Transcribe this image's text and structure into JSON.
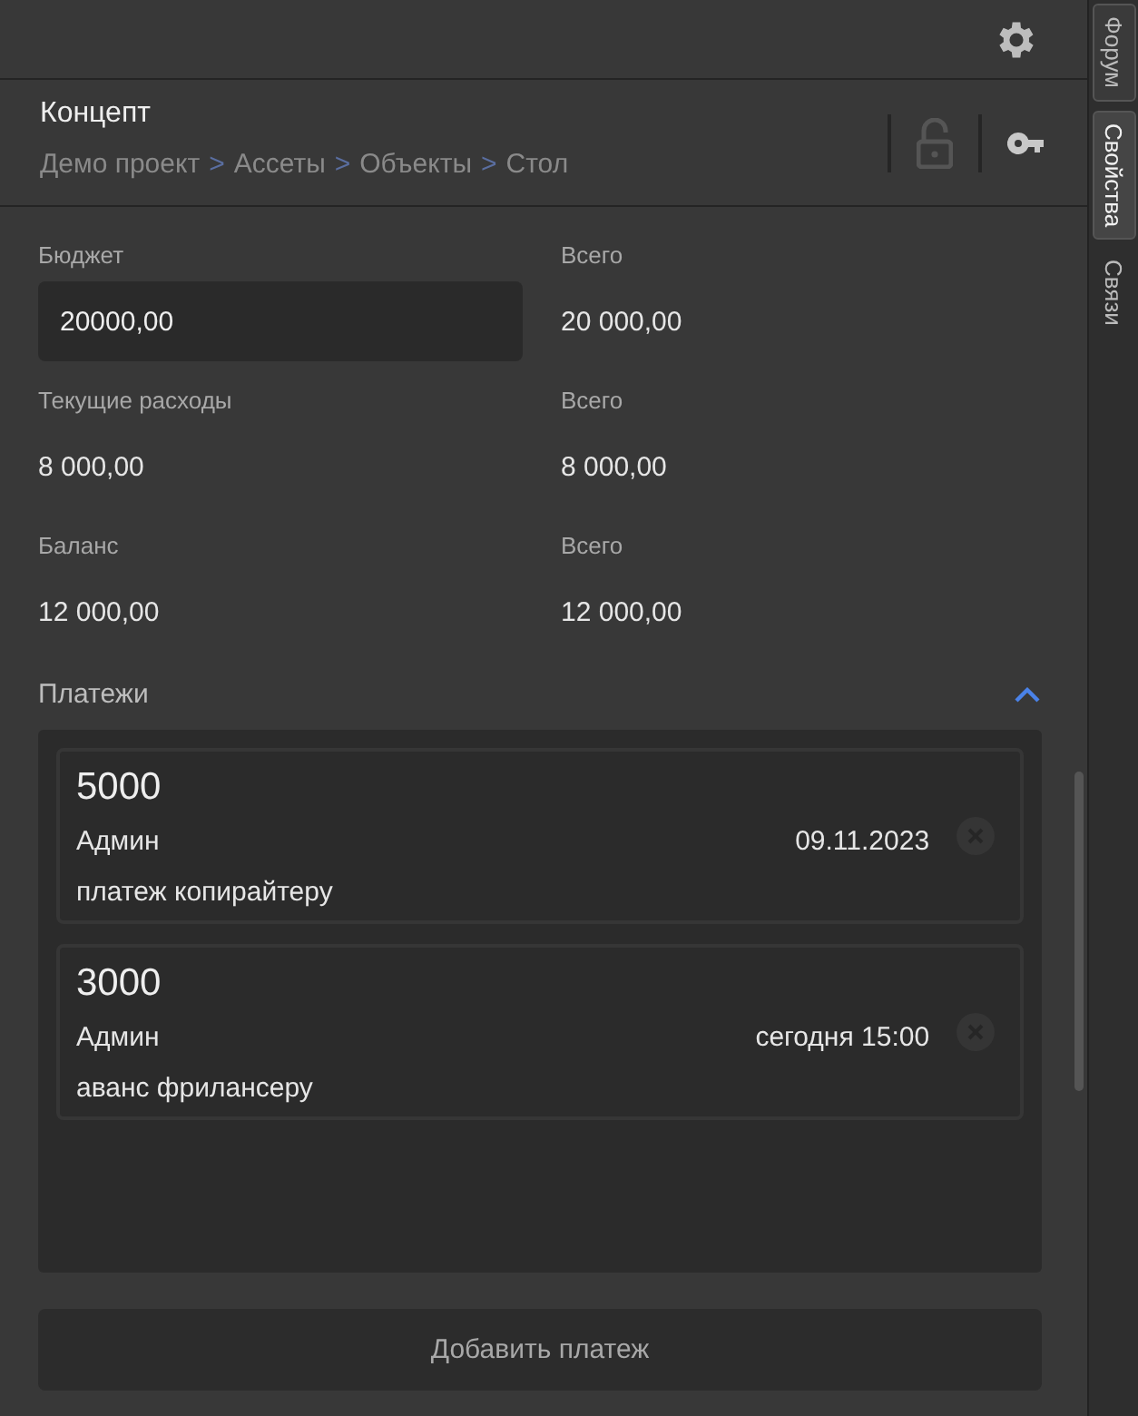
{
  "header": {
    "title": "Концепт",
    "breadcrumb": [
      {
        "kind": "crumb",
        "text": "Демо проект"
      },
      {
        "kind": "sep",
        "text": ">"
      },
      {
        "kind": "crumb",
        "text": "Ассеты"
      },
      {
        "kind": "sep",
        "text": ">"
      },
      {
        "kind": "crumb",
        "text": "Объекты"
      },
      {
        "kind": "sep",
        "text": ">"
      },
      {
        "kind": "crumb",
        "text": "Стол"
      }
    ],
    "locked": false
  },
  "fields": [
    {
      "label": "Бюджет",
      "kind": "input",
      "value": "20000,00",
      "total_label": "Всего",
      "total": "20 000,00"
    },
    {
      "label": "Текущие расходы",
      "kind": "text",
      "value": "8 000,00",
      "total_label": "Всего",
      "total": "8 000,00"
    },
    {
      "label": "Баланс",
      "kind": "text",
      "value": "12 000,00",
      "total_label": "Всего",
      "total": "12 000,00"
    }
  ],
  "payments": {
    "title": "Платежи",
    "expanded": true,
    "items": [
      {
        "amount": "5000",
        "author": "Админ",
        "date": "09.11.2023",
        "note": "платеж копирайтеру"
      },
      {
        "amount": "3000",
        "author": "Админ",
        "date": "сегодня 15:00",
        "note": "аванс фрилансеру"
      }
    ],
    "add_button": "Добавить платеж"
  },
  "side_tabs": [
    {
      "label": "Форум",
      "selected": false,
      "raised": true
    },
    {
      "label": "Свойства",
      "selected": true,
      "raised": true
    },
    {
      "label": "Связи",
      "selected": false,
      "raised": false
    }
  ]
}
